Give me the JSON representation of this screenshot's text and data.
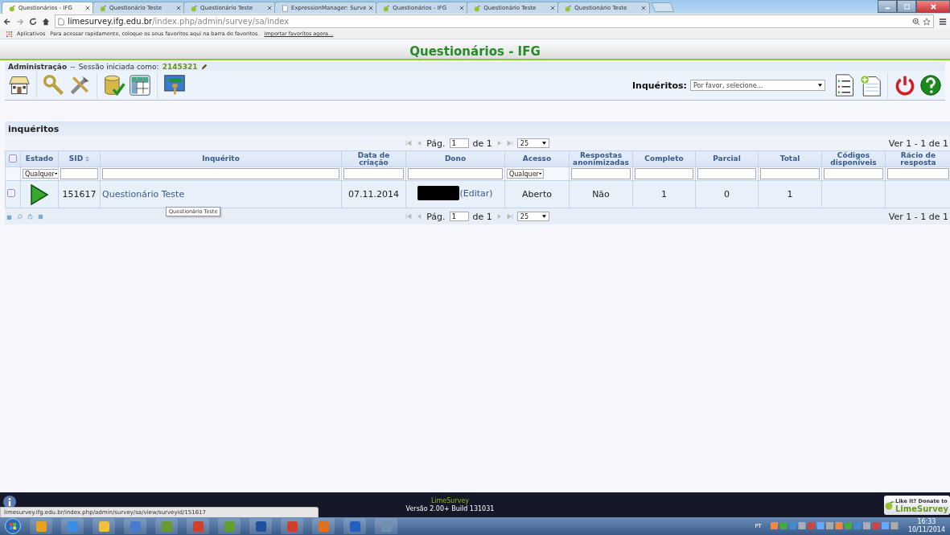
{
  "browser": {
    "tabs": [
      {
        "title": "Questionários - IFG",
        "selected": true,
        "kind": "survey"
      },
      {
        "title": "Questionário Teste",
        "selected": false,
        "kind": "survey"
      },
      {
        "title": "Questionário Teste",
        "selected": false,
        "kind": "survey"
      },
      {
        "title": "ExpressionManager: Surve",
        "selected": false,
        "kind": "page"
      },
      {
        "title": "Questionários - IFG",
        "selected": false,
        "kind": "survey"
      },
      {
        "title": "Questionário Teste",
        "selected": false,
        "kind": "survey"
      },
      {
        "title": "Questionário Teste",
        "selected": false,
        "kind": "survey"
      }
    ],
    "address": {
      "host": "limesurvey.ifg.edu.br",
      "path": "/index.php/admin/survey/sa/index"
    },
    "bookmarks": {
      "apps": "Aplicativos",
      "hint": "Para acessar rapidamente, coloque os seus favoritos aqui na barra de favoritos.",
      "import_link": "Importar favoritos agora..."
    }
  },
  "page": {
    "title": "Questionários - IFG",
    "admin": {
      "label": "Administração",
      "separator": "--",
      "session_label": "Sessão iniciada como:",
      "user": "2145321"
    },
    "survey_select": {
      "label": "Inquéritos:",
      "placeholder": "Por favor, selecione..."
    }
  },
  "survey_list": {
    "heading": "inquéritos",
    "pagers": [
      {
        "page_label": "Pág.",
        "page": "1",
        "of": "de 1",
        "page_size": "25",
        "range": "Ver 1 - 1 de 1"
      },
      {
        "page_label": "Pág.",
        "page": "1",
        "of": "de 1",
        "page_size": "25",
        "range": "Ver 1 - 1 de 1"
      }
    ],
    "header_checkbox": {
      "checked": false
    },
    "columns": [
      {
        "label": "Estado",
        "sorted": false,
        "kind": "select",
        "filter_value": "Qualquer"
      },
      {
        "label": "SID",
        "sorted": true,
        "kind": "text"
      },
      {
        "label": "Inquérito",
        "sorted": false,
        "kind": "text"
      },
      {
        "label": "Data de criação",
        "sorted": false,
        "kind": "text"
      },
      {
        "label": "Dono",
        "sorted": false,
        "kind": "text"
      },
      {
        "label": "Acesso",
        "sorted": false,
        "kind": "select",
        "filter_value": "Qualquer"
      },
      {
        "label": "Respostas anonimizadas",
        "sorted": false,
        "kind": "text"
      },
      {
        "label": "Completo",
        "sorted": false,
        "kind": "text"
      },
      {
        "label": "Parcial",
        "sorted": false,
        "kind": "text"
      },
      {
        "label": "Total",
        "sorted": false,
        "kind": "text"
      },
      {
        "label": "Códigos disponíveis",
        "sorted": false,
        "kind": "text"
      },
      {
        "label": "Rácio de resposta",
        "sorted": false,
        "kind": "text"
      }
    ],
    "rows": [
      {
        "checked": false,
        "cells": [
          {
            "kind": "status",
            "active": true
          },
          {
            "kind": "text",
            "text": "151617"
          },
          {
            "kind": "link",
            "text": "Questionário Teste"
          },
          {
            "kind": "text",
            "text": "07.11.2014"
          },
          {
            "kind": "owner",
            "redacted": true,
            "text": "(Editar)"
          },
          {
            "kind": "text",
            "text": "Aberto"
          },
          {
            "kind": "text",
            "text": "Não"
          },
          {
            "kind": "text",
            "text": "1"
          },
          {
            "kind": "text",
            "text": "0"
          },
          {
            "kind": "text",
            "text": "1"
          },
          {
            "kind": "empty"
          },
          {
            "kind": "empty"
          }
        ]
      }
    ],
    "tooltip": "Questionário Teste"
  },
  "footer": {
    "app": "LimeSurvey",
    "version": "Versão 2.00+ Build 131031",
    "donate": "Like it? Donate to",
    "donate_brand": "LimeSurvey"
  },
  "status_url": "limesurvey.ifg.edu.br/index.php/admin/survey/sa/view/surveyid/151617",
  "taskbar": {
    "language": "PT",
    "time": "16:33",
    "date": "10/11/2014"
  }
}
